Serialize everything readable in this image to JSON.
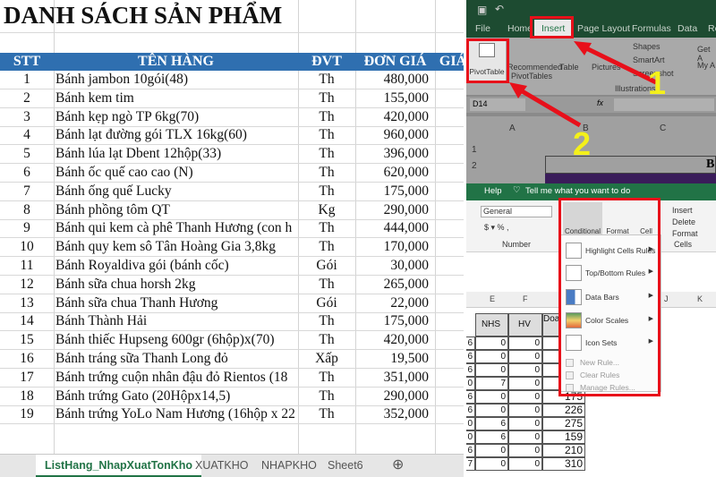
{
  "left": {
    "title": "DANH SÁCH SẢN PHẨM",
    "headers": [
      "STT",
      "TÊN HÀNG",
      "ĐVT",
      "ĐƠN GIÁ",
      "GIÁ"
    ],
    "rows": [
      [
        "1",
        "Bánh jambon 10gói(48)",
        "Th",
        "480,000"
      ],
      [
        "2",
        "Bánh kem tim",
        "Th",
        "155,000"
      ],
      [
        "3",
        "Bánh kẹp ngò TP 6kg(70)",
        "Th",
        "420,000"
      ],
      [
        "4",
        "Bánh lạt đường gói TLX 16kg(60)",
        "Th",
        "960,000"
      ],
      [
        "5",
        "Bánh lúa lạt Dbent 12hộp(33)",
        "Th",
        "396,000"
      ],
      [
        "6",
        "Bánh ốc quế cao cao (N)",
        "Th",
        "620,000"
      ],
      [
        "7",
        "Bánh ống quế Lucky",
        "Th",
        "175,000"
      ],
      [
        "8",
        "Bánh phồng tôm QT",
        "Kg",
        "290,000"
      ],
      [
        "9",
        "Bánh qui kem cà phê Thanh Hương (con h",
        "Th",
        "444,000"
      ],
      [
        "10",
        "Bánh quy kem sô Tân Hoàng Gia 3,8kg",
        "Th",
        "170,000"
      ],
      [
        "11",
        "Bánh Royaldiva gói (bánh cốc)",
        "Gói",
        "30,000"
      ],
      [
        "12",
        "Bánh sữa chua horsh 2kg",
        "Th",
        "265,000"
      ],
      [
        "13",
        "Bánh sữa chua Thanh Hương",
        "Gói",
        "22,000"
      ],
      [
        "14",
        "Bánh Thành Hải",
        "Th",
        "175,000"
      ],
      [
        "15",
        "Bánh thiếc Hupseng 600gr (6hộp)x(70)",
        "Th",
        "420,000"
      ],
      [
        "16",
        "Bánh tráng sữa Thanh Long đỏ",
        "Xấp",
        "19,500"
      ],
      [
        "17",
        "Bánh trứng cuộn nhân đậu đỏ Rientos (18",
        "Th",
        "351,000"
      ],
      [
        "18",
        "Bánh trứng Gato (20Hộpx14,5)",
        "Th",
        "290,000"
      ],
      [
        "19",
        "Bánh trứng YoLo Nam Hương (16hộp x 22",
        "Th",
        "352,000"
      ]
    ],
    "sheet_tabs": [
      "ListHang_NhapXuatTonKho",
      "XUATKHO",
      "NHAPKHO",
      "Sheet6"
    ],
    "add_sheet": "⊕"
  },
  "top_right": {
    "tabs": [
      "File",
      "Home",
      "Insert",
      "Page Layout",
      "Formulas",
      "Data",
      "Re"
    ],
    "pivot": "PivotTable",
    "recommended": "Recommended PivotTables",
    "table": "Table",
    "pictures": "Pictures",
    "shapes": "Shapes",
    "smartart": "SmartArt",
    "screenshot": "Screenshot",
    "illustrations": "Illustrations",
    "get_addins": "Get A",
    "my_addins": "My A",
    "name_box": "D14",
    "fx": "fx",
    "cols": [
      "A",
      "B",
      "C"
    ],
    "rows": [
      "1",
      "2"
    ],
    "cell_b2": "B",
    "step1": "1",
    "step2": "2"
  },
  "bottom_right": {
    "tabs": [
      "Help",
      "Tell me what you want to do"
    ],
    "number_format": "General",
    "number_group": "Number",
    "cells_group": "Cells",
    "cond_format": "Conditional Formatting",
    "format_table": "Format as Table",
    "cell_styles": "Cell Styles",
    "insert": "Insert",
    "delete": "Delete",
    "format": "Format",
    "menu": [
      "Highlight Cells Rules",
      "Top/Bottom Rules",
      "Data Bars",
      "Color Scales",
      "Icon Sets"
    ],
    "menu_small": [
      "New Rule...",
      "Clear Rules",
      "Manage Rules..."
    ],
    "cols": [
      "E",
      "F",
      "J",
      "K"
    ],
    "table_headers": [
      "NHS",
      "HV",
      "Doa"
    ],
    "table_rows": [
      [
        "6",
        "0",
        "0",
        ""
      ],
      [
        "6",
        "0",
        "0",
        ""
      ],
      [
        "6",
        "0",
        "0",
        ""
      ],
      [
        "0",
        "7",
        "0",
        ""
      ],
      [
        "6",
        "0",
        "0",
        "175"
      ],
      [
        "6",
        "0",
        "0",
        "226"
      ],
      [
        "0",
        "6",
        "0",
        "275"
      ],
      [
        "0",
        "6",
        "0",
        "159"
      ],
      [
        "6",
        "0",
        "0",
        "210"
      ],
      [
        "7",
        "0",
        "0",
        "310"
      ]
    ]
  }
}
